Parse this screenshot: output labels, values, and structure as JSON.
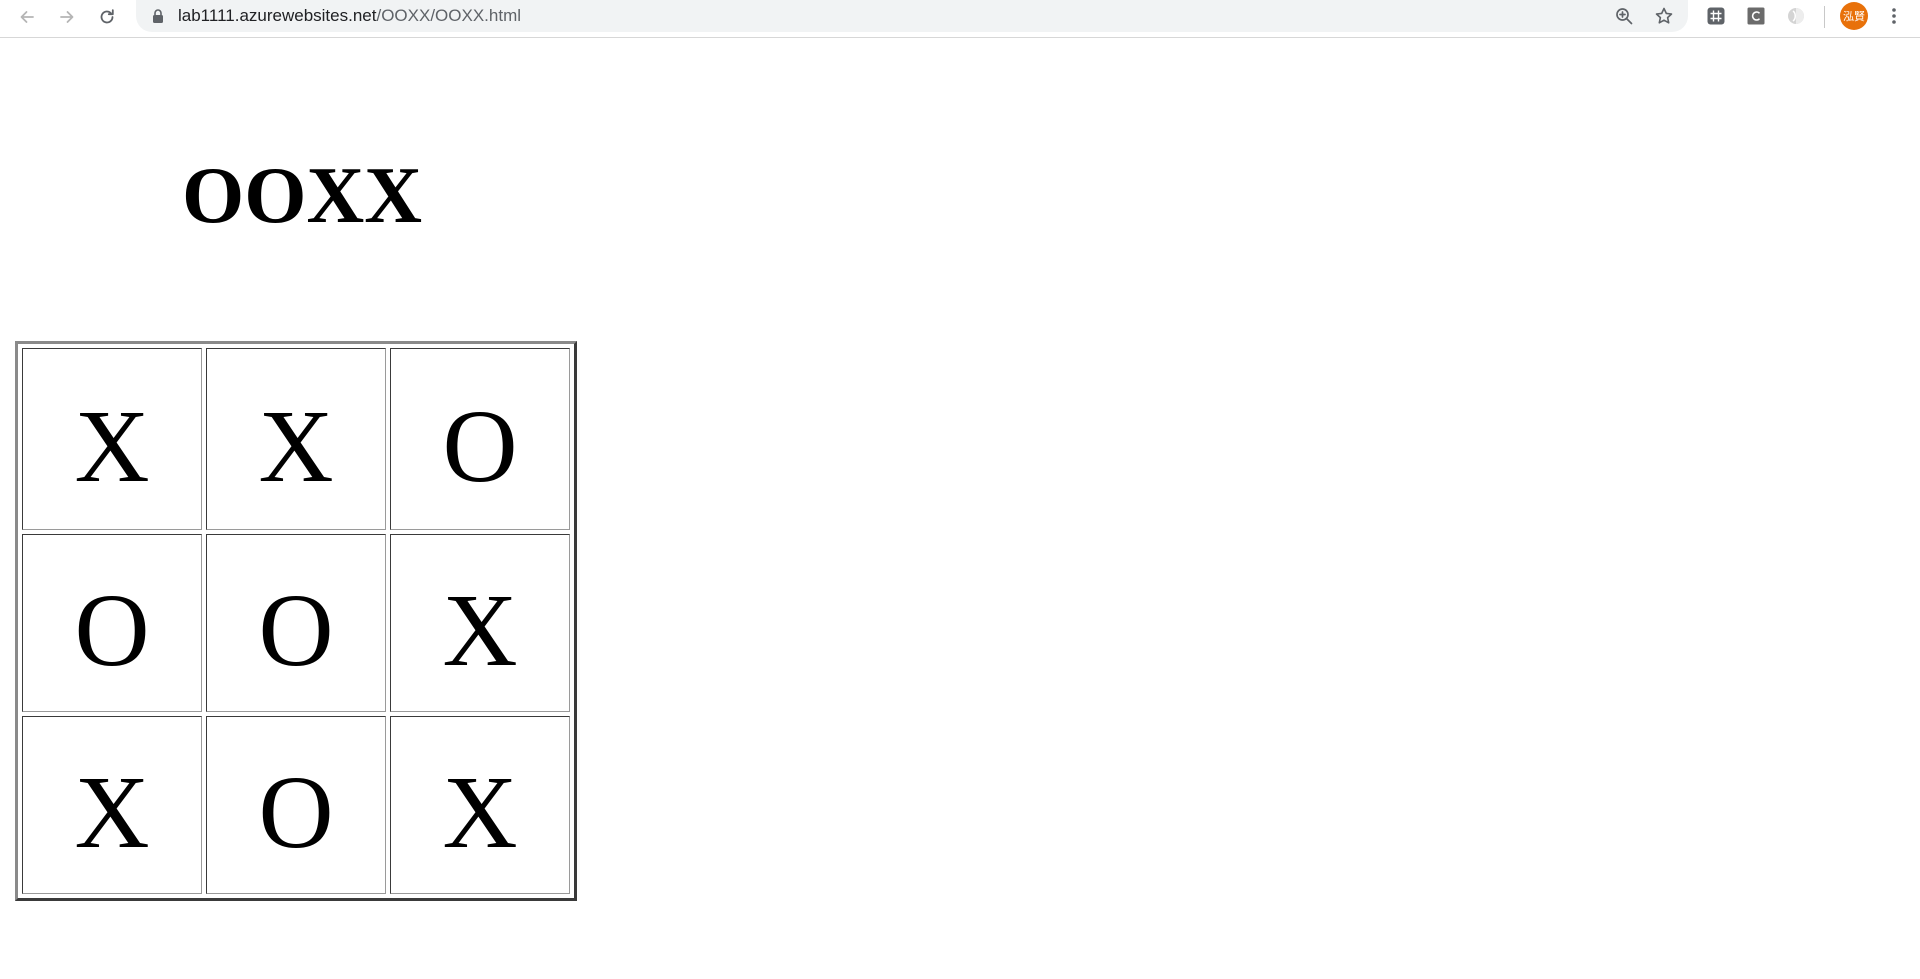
{
  "browser": {
    "url_host": "lab1111.azurewebsites.net",
    "url_path": "/OOXX/OOXX.html",
    "profile_initials": "泓賢",
    "icons": {
      "back": "back-arrow-icon",
      "forward": "forward-arrow-icon",
      "reload": "reload-icon",
      "lock": "lock-icon",
      "zoom": "zoom-icon",
      "bookmark": "star-icon",
      "extension_1": "grid-extension-icon",
      "extension_2": "c-extension-icon",
      "extension_3": "circle-extension-icon",
      "menu": "kebab-menu-icon"
    },
    "accent_color": "#e8710a"
  },
  "page": {
    "title": "OOXX",
    "board": [
      [
        "X",
        "X",
        "O"
      ],
      [
        "O",
        "O",
        "X"
      ],
      [
        "X",
        "O",
        "X"
      ]
    ]
  }
}
